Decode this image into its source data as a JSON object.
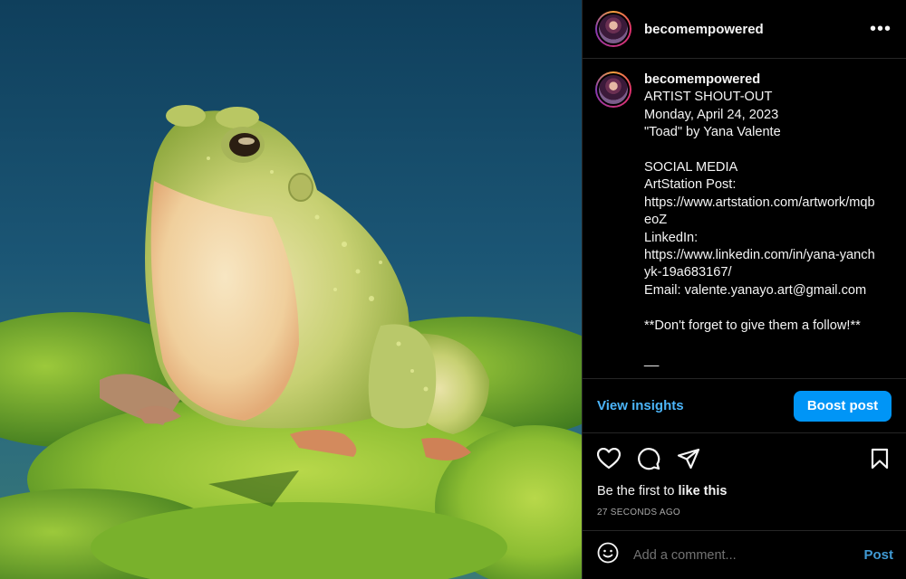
{
  "post": {
    "media_alt": "3D render of a green toad sitting on lily pads",
    "colors": {
      "background": "#000000",
      "accent": "#0095f6",
      "link": "#4cb5f9",
      "muted": "#a8a8a8",
      "border": "#262626"
    }
  },
  "header": {
    "username": "becomempowered",
    "more_icon": "more-horizontal-icon"
  },
  "caption": {
    "username": "becomempowered",
    "lines": [
      "ARTIST SHOUT-OUT",
      "Monday, April 24, 2023",
      "\"Toad\" by Yana Valente",
      "",
      "SOCIAL MEDIA",
      "ArtStation Post:",
      "https://www.artstation.com/artwork/mqbeoZ",
      "LinkedIn:",
      "https://www.linkedin.com/in/yana-yanchyk-19a683167/",
      "Email: valente.yanayo.art@gmail.com",
      "",
      "**Don't forget to give them a follow!**",
      "",
      "__"
    ]
  },
  "insights": {
    "view_label": "View insights",
    "boost_label": "Boost post"
  },
  "actions": {
    "like_icon": "heart-icon",
    "comment_icon": "comment-icon",
    "share_icon": "send-icon",
    "save_icon": "bookmark-icon"
  },
  "likes": {
    "prefix": "Be the first to ",
    "link": "like this"
  },
  "timestamp": "27 SECONDS AGO",
  "comment": {
    "emoji_icon": "emoji-icon",
    "placeholder": "Add a comment...",
    "post_label": "Post"
  }
}
